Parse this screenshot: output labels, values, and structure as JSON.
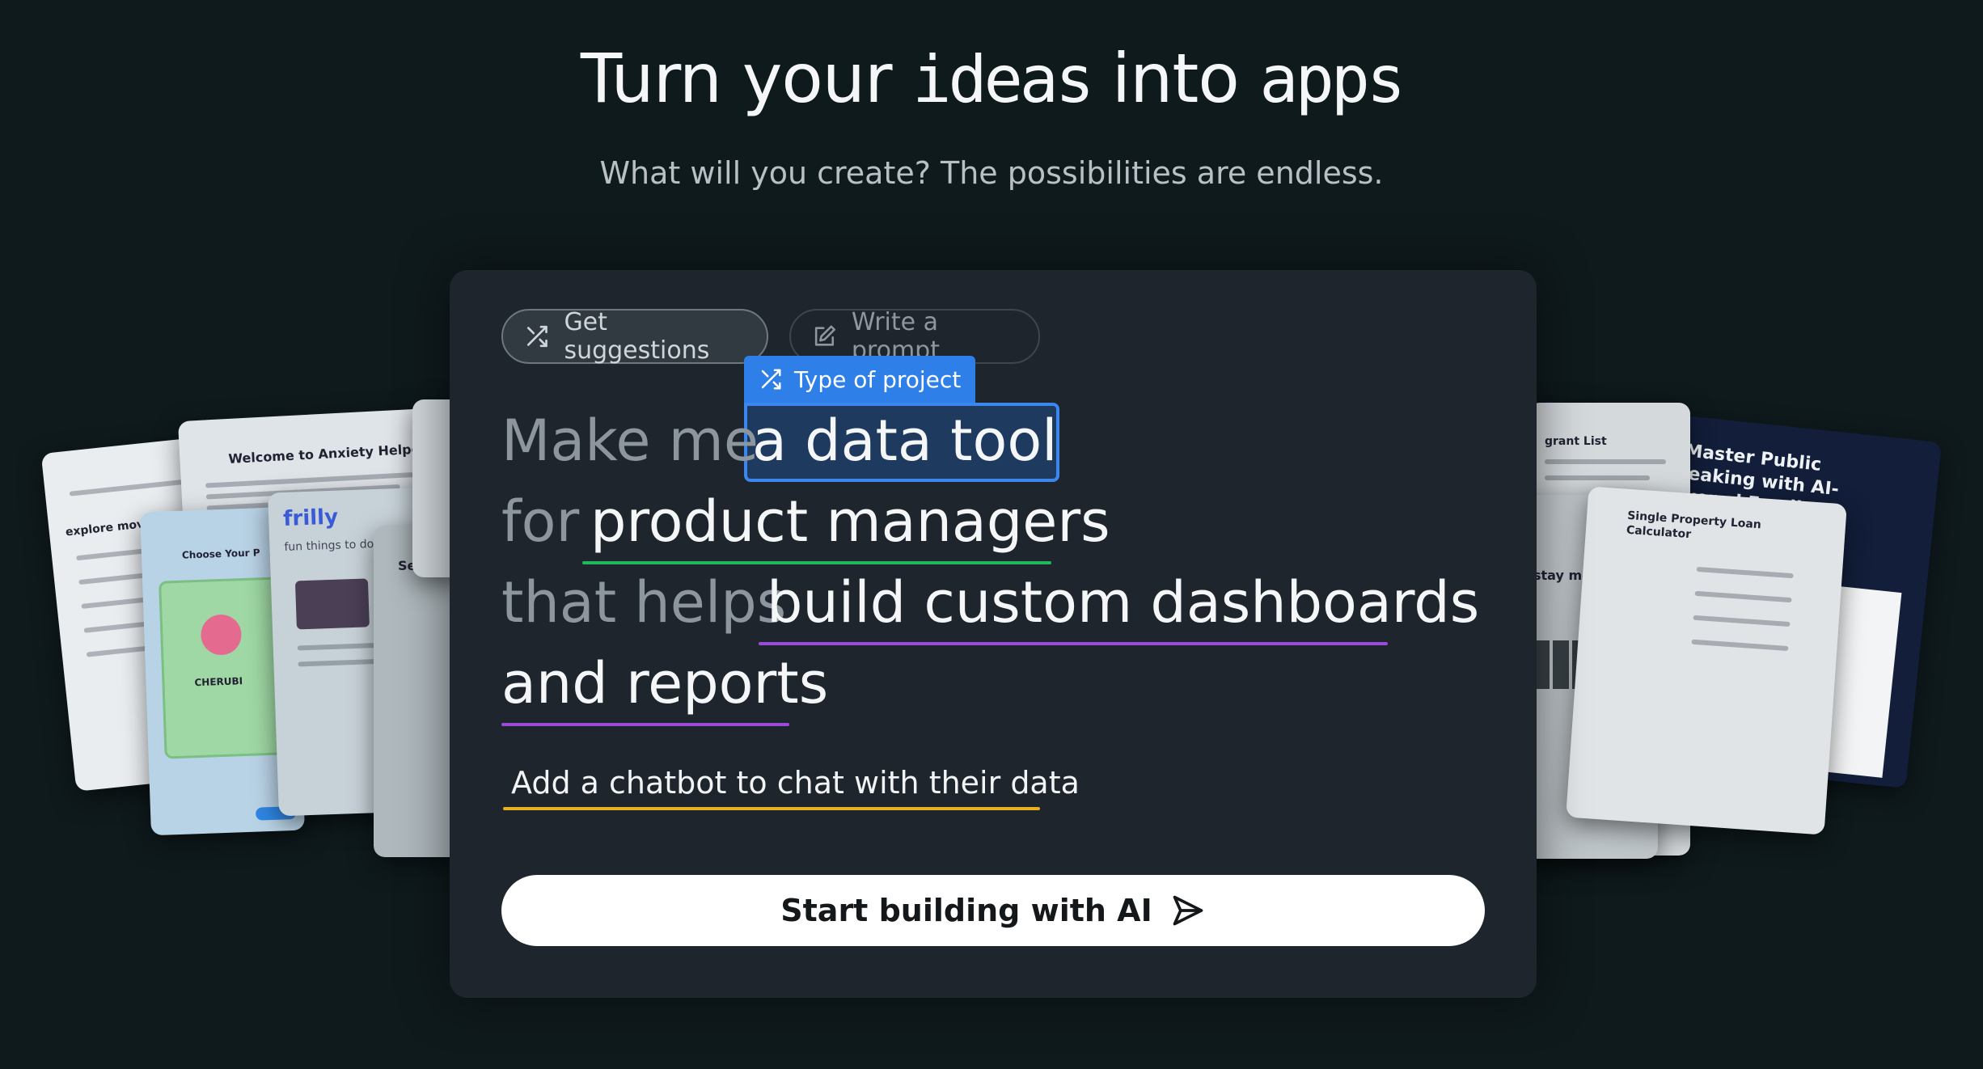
{
  "hero": {
    "title_start": "Turn your ",
    "title_pixel": "ideas",
    "title_mid": " into ",
    "title_end": "apps",
    "subtitle": "What will you create? The possibilities are endless."
  },
  "mode_tabs": {
    "suggestions": "Get suggestions",
    "prompt": "Write a prompt"
  },
  "project_tag": "Type of project",
  "sentence": {
    "prefix1": "Make me",
    "project_type": "a data tool",
    "prefix2": "for",
    "audience": "product managers",
    "prefix3": "that helps",
    "goal_line1": "build custom dashboards",
    "goal_line2": "and reports",
    "addon": "Add a chatbot to chat with their data"
  },
  "cta_label": "Start building with AI",
  "previews": {
    "left_a_title": "explore movies in",
    "left_b_title": "Welcome to Anxiety Helper",
    "left_c_title": "Choose Your P",
    "left_c_name": "CHERUBI",
    "left_d_title": "frilly",
    "left_d_sub": "fun things to do in",
    "left_e_title": "See pr",
    "right_a_title": "Master Public Speaking with AI-Powered Feedback",
    "right_b_title": "grant List",
    "right_c_title": "stay motivated",
    "right_d_title": "Single Property Loan Calculator"
  },
  "colors": {
    "background": "#0f1a1d",
    "panel": "#1e252c",
    "highlight_blue": "#3b86ef",
    "underline_green": "#1fb85c",
    "underline_purple": "#9a4bdc",
    "underline_yellow": "#e8b021"
  }
}
